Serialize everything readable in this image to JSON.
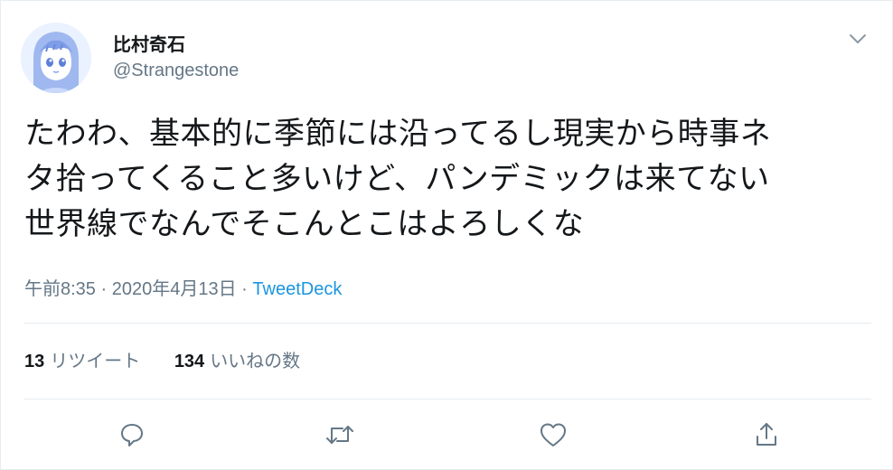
{
  "user": {
    "display_name": "比村奇石",
    "handle": "@Strangestone"
  },
  "tweet": {
    "text_lines": [
      "たわわ、基本的に季節には沿ってるし現実から時事ネ",
      "タ拾ってくること多いけど、パンデミックは来てない",
      "世界線でなんでそこんとこはよろしくな"
    ],
    "time": "午前8:35",
    "separator": "·",
    "date": "2020年4月13日",
    "source": "TweetDeck"
  },
  "stats": {
    "retweets_count": "13",
    "retweets_label": "リツイート",
    "likes_count": "134",
    "likes_label": "いいねの数"
  },
  "icons": {
    "menu": "chevron-down-icon",
    "reply": "reply-icon",
    "retweet": "retweet-icon",
    "like": "heart-icon",
    "share": "share-icon"
  },
  "colors": {
    "text": "#14171a",
    "muted": "#657786",
    "link": "#1b95e0",
    "border": "#e6ecf0"
  }
}
